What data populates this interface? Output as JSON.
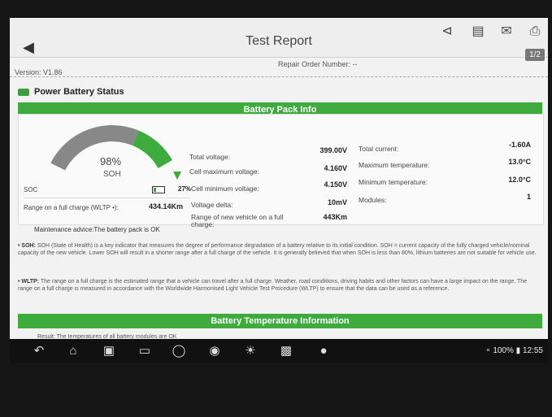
{
  "header": {
    "title": "Test Report",
    "page_indicator": "1/2",
    "version": "Version: V1.86",
    "repair_order": "Repair Order Number: --",
    "tools": [
      "share-icon",
      "pdf-icon",
      "mail-icon",
      "print-icon"
    ]
  },
  "section": {
    "title": "Power Battery Status",
    "pack_info_label": "Battery Pack Info",
    "temp_info_label": "Battery Temperature Information",
    "temp_info_text": "Result: The temperatures of all battery modules are OK"
  },
  "gauge": {
    "soh_value": "98%",
    "soh_label": "SOH",
    "soh_fraction": 0.98,
    "soc_label": "SOC",
    "soc_value": "27%",
    "range_label": "Range on a full charge (WLTP •):",
    "range_value": "434.14Km"
  },
  "metrics_mid": [
    {
      "label": "Total voltage:",
      "value": "399.00V"
    },
    {
      "label": "Cell maximum voltage:",
      "value": "4.160V"
    },
    {
      "label": "Cell minimum voltage:",
      "value": "4.150V"
    },
    {
      "label": "Voltage delta:",
      "value": "10mV"
    },
    {
      "label": "Range of new vehicle on a full charge:",
      "value": "443Km"
    }
  ],
  "metrics_right": [
    {
      "label": "Total current:",
      "value": "-1.60A"
    },
    {
      "label": "Maximum temperature:",
      "value": "13.0°C"
    },
    {
      "label": "Minimum temperature:",
      "value": "12.0°C"
    },
    {
      "label": "Modules:",
      "value": "1"
    }
  ],
  "maintenance": "Maintenance advice:The battery pack is OK",
  "soh_note_key": "• SOH:",
  "soh_note": "SOH (State of Health) is a key indicator that measures the degree of performance degradation of a battery relative to its initial condition. SOH = current capacity of the fully charged vehicle/nominal capacity of the new vehicle. Lower SOH will result in a shorter range after a full charge of the vehicle. It is generally believed that when SOH is less than 80%, lithium batteries are not suitable for vehicle use.",
  "wltp_note_key": "• WLTP:",
  "wltp_note": "The range on a full charge is the estimated range that a vehicle can travel after a full charge. Weather, road conditions, driving habits and other factors can have a large impact on the range. The range on a full charge is measured in accordance with the Worldwide Harmonised Light Vehicle Test Procedure (WLTP) to ensure that the data can be used as a reference.",
  "statusbar": {
    "battery": "100%",
    "time": "12:55"
  },
  "colors": {
    "accent_green": "#3dab3d",
    "gauge_gray": "#888888"
  }
}
